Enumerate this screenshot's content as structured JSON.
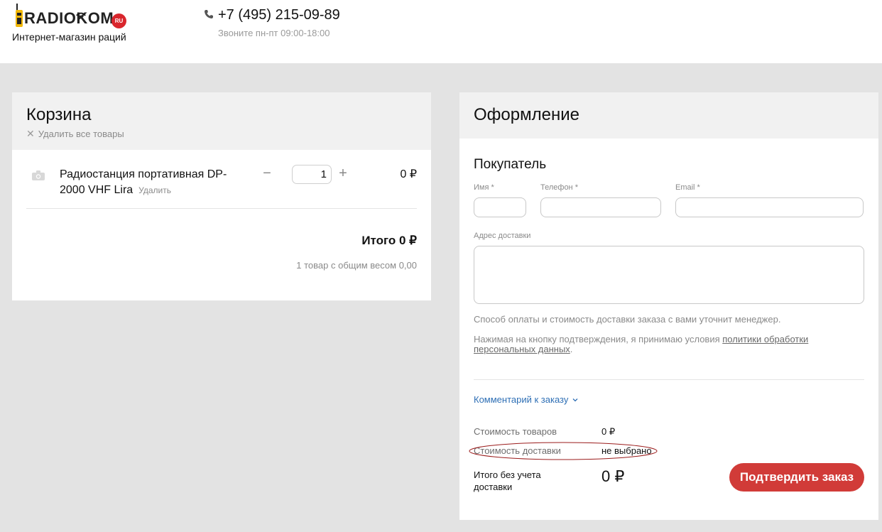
{
  "header": {
    "logo_text": "RADIOKOM",
    "logo_badge": "RU",
    "tagline": "Интернет-магазин раций",
    "phone": "+7 (495) 215-09-89",
    "hours": "Звоните пн-пт 09:00-18:00",
    "icons": [
      "walkie-talkie-icon",
      "phone-icon"
    ],
    "colors": {
      "brand_yellow": "#f2b705",
      "brand_red": "#d9262d"
    }
  },
  "cart": {
    "title": "Корзина",
    "clear_label": "Удалить все товары",
    "items": [
      {
        "name": "Радиостанция портативная DP-2000 VHF Lira",
        "remove_label": "Удалить",
        "quantity": "1",
        "price": "0 ₽"
      }
    ],
    "total": "Итого 0 ₽",
    "summary": "1 товар с общим весом 0,00"
  },
  "checkout": {
    "title": "Оформление",
    "buyer_title": "Покупатель",
    "fields": {
      "name_label": "Имя *",
      "phone_label": "Телефон *",
      "email_label": "Email *",
      "address_label": "Адрес доставки",
      "name_value": "",
      "phone_value": "",
      "email_value": "",
      "address_value": ""
    },
    "note_payment": "Способ оплаты и стоимость доставки заказа с вами уточнит менеджер.",
    "note_consent_prefix": "Нажимая на кнопку подтверждения, я принимаю условия ",
    "note_consent_link": "политики обработки персональных данных",
    "note_consent_suffix": ".",
    "comment_link": "Комментарий к заказу",
    "goods_cost_label": "Стоимость товаров",
    "goods_cost_value": "0 ₽",
    "delivery_cost_label": "Стоимость доставки",
    "delivery_cost_value": "не выбрано",
    "grand_total_label": "Итого без учета доставки",
    "grand_total_value": "0 ₽",
    "confirm_label": "Подтвердить заказ",
    "colors": {
      "accent_red": "#d13b38",
      "link_blue": "#2e6fb5"
    }
  }
}
